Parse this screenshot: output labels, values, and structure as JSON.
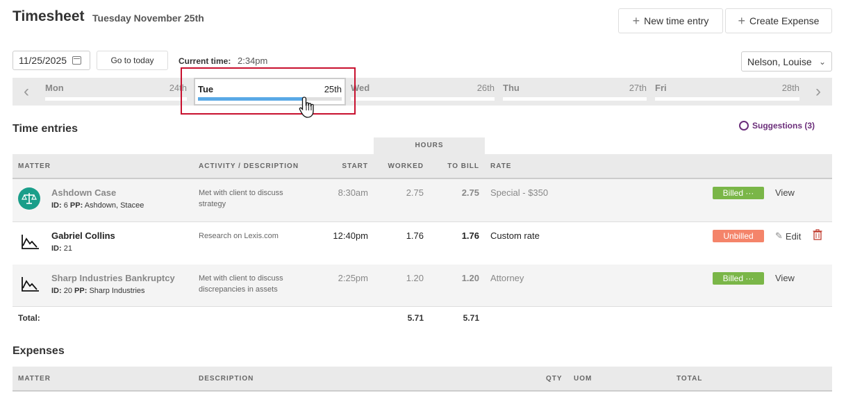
{
  "header": {
    "title": "Timesheet",
    "subtitle": "Tuesday November 25th",
    "new_time_entry": "New time entry",
    "create_expense": "Create Expense"
  },
  "controls": {
    "date_value": "11/25/2025",
    "go_to_today": "Go to today",
    "current_time_label": "Current time:",
    "current_time_value": "2:34pm",
    "user": "Nelson, Louise"
  },
  "days": [
    {
      "name": "Mon",
      "num": "24th",
      "selected": false,
      "progress": 0
    },
    {
      "name": "Tue",
      "num": "25th",
      "selected": true,
      "progress": 0.73
    },
    {
      "name": "Wed",
      "num": "26th",
      "selected": false,
      "progress": 0
    },
    {
      "name": "Thu",
      "num": "27th",
      "selected": false,
      "progress": 0
    },
    {
      "name": "Fri",
      "num": "28th",
      "selected": false,
      "progress": 0
    }
  ],
  "time_entries": {
    "title": "Time entries",
    "suggestions": "Suggestions (3)",
    "hours_group": "HOURS",
    "columns": {
      "matter": "MATTER",
      "activity": "ACTIVITY / DESCRIPTION",
      "start": "START",
      "worked": "WORKED",
      "to_bill": "TO BILL",
      "rate": "RATE"
    },
    "rows": [
      {
        "matter": "Ashdown Case",
        "id_label": "ID:",
        "id": "6",
        "pp_label": "PP:",
        "pp": "Ashdown, Stacee",
        "description": "Met with client to discuss strategy",
        "start": "8:30am",
        "worked": "2.75",
        "to_bill": "2.75",
        "rate": "Special - $350",
        "status": "Billed ···",
        "action": "View",
        "icon": "scales-icon"
      },
      {
        "matter": "Gabriel Collins",
        "id_label": "ID:",
        "id": "21",
        "description": "Research on Lexis.com",
        "start": "12:40pm",
        "worked": "1.76",
        "to_bill": "1.76",
        "rate": "Custom rate",
        "status": "Unbilled",
        "action": "Edit",
        "icon": "chart-down-icon"
      },
      {
        "matter": "Sharp Industries Bankruptcy",
        "id_label": "ID:",
        "id": "20",
        "pp_label": "PP:",
        "pp": "Sharp Industries",
        "description": "Met with client to discuss discrepancies in assets",
        "start": "2:25pm",
        "worked": "1.20",
        "to_bill": "1.20",
        "rate": "Attorney",
        "status": "Billed ···",
        "action": "View",
        "icon": "chart-down-icon"
      }
    ],
    "total_label": "Total:",
    "total_worked": "5.71",
    "total_to_bill": "5.71"
  },
  "expenses": {
    "title": "Expenses",
    "columns": {
      "matter": "MATTER",
      "description": "DESCRIPTION",
      "qty": "QTY",
      "uom": "UOM",
      "total": "TOTAL"
    }
  },
  "colors": {
    "billed": "#7ab648",
    "unbilled": "#f4846a",
    "progress": "#5aa9e6",
    "highlight": "#c8102e",
    "suggestions": "#6b2e7a",
    "matter_icon_bg": "#1a9e8a"
  }
}
